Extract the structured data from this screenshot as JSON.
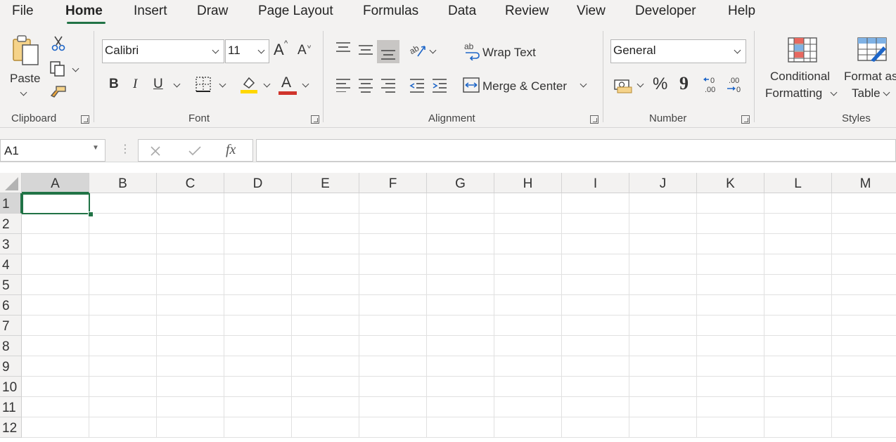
{
  "menu": {
    "tabs": [
      {
        "label": "File"
      },
      {
        "label": "Home"
      },
      {
        "label": "Insert"
      },
      {
        "label": "Draw"
      },
      {
        "label": "Page Layout"
      },
      {
        "label": "Formulas"
      },
      {
        "label": "Data"
      },
      {
        "label": "Review"
      },
      {
        "label": "View"
      },
      {
        "label": "Developer"
      },
      {
        "label": "Help"
      }
    ],
    "active_tab": "Home"
  },
  "ribbon": {
    "clipboard": {
      "paste_label": "Paste",
      "group_label": "Clipboard"
    },
    "font": {
      "font_name": "Calibri",
      "font_size": "11",
      "group_label": "Font",
      "bold": "B",
      "italic": "I",
      "underline": "U",
      "font_color_glyph": "A",
      "grow_glyph": "A",
      "shrink_glyph": "A"
    },
    "alignment": {
      "wrap_text": "Wrap Text",
      "merge_center": "Merge & Center",
      "group_label": "Alignment"
    },
    "number": {
      "format": "General",
      "percent": "%",
      "comma": "9",
      "group_label": "Number"
    },
    "styles": {
      "conditional_line1": "Conditional",
      "conditional_line2": "Formatting",
      "format_table_line1": "Format as",
      "format_table_line2": "Table",
      "group_label": "Styles"
    }
  },
  "formula_bar": {
    "name_box": "A1",
    "fx": "fx",
    "formula": ""
  },
  "sheet": {
    "columns": [
      "A",
      "B",
      "C",
      "D",
      "E",
      "F",
      "G",
      "H",
      "I",
      "J",
      "K",
      "L",
      "M"
    ],
    "rows": [
      "1",
      "2",
      "3",
      "4",
      "5",
      "6",
      "7",
      "8",
      "9",
      "10",
      "11",
      "12"
    ],
    "active_cell": "A1"
  },
  "colors": {
    "accent": "#217346",
    "ribbon_bg": "#f3f2f1",
    "font_color_bar": "#d0342c",
    "highlight_bar": "#ffd700"
  }
}
